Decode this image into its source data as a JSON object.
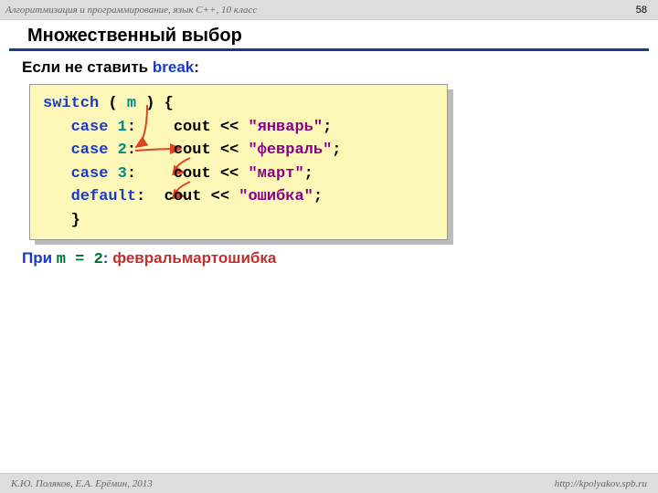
{
  "header": {
    "course": "Алгоритмизация и программирование, язык  C++, 10 класс",
    "page": "58"
  },
  "title": "Множественный выбор",
  "subhead": {
    "prefix": "Если не ставить ",
    "kw": "break",
    "suffix": ":"
  },
  "code": {
    "l1a": "switch",
    "l1b": " ( ",
    "l1c": "m",
    "l1d": " ) {",
    "l2a": "   case",
    "l2n": " 1",
    "l2b": ":    cout << ",
    "l2s": "\"январь\"",
    "l2e": ";",
    "l3a": "   case",
    "l3n": " 2",
    "l3b": ":    cout << ",
    "l3s": "\"февраль\"",
    "l3e": ";",
    "l4a": "   case",
    "l4n": " 3",
    "l4b": ":    cout << ",
    "l4s": "\"март\"",
    "l4e": ";",
    "l5a": "   default",
    "l5b": ":  cout << ",
    "l5s": "\"ошибка\"",
    "l5e": ";",
    "l6": "   }"
  },
  "result": {
    "label": "При ",
    "mvar": "m = 2",
    "colon": ":    ",
    "output": "февральмартошибка"
  },
  "footer": {
    "left": " К.Ю. Поляков, Е.А. Ерёмин, 2013",
    "right": "http://kpolyakov.spb.ru"
  }
}
